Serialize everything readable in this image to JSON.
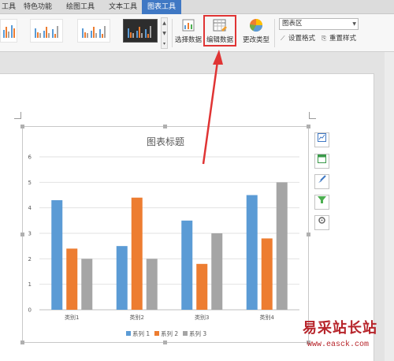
{
  "tabs": [
    {
      "label": "工具",
      "active": false
    },
    {
      "label": "特色功能",
      "active": false
    },
    {
      "label": "绘图工具",
      "active": false
    },
    {
      "label": "文本工具",
      "active": false
    },
    {
      "label": "图表工具",
      "active": true
    }
  ],
  "ribbon": {
    "select_data": "选择数据",
    "edit_data": "编辑数据",
    "change_type": "更改类型",
    "element_dropdown": "图表区",
    "set_format": "设置格式",
    "reset_style": "重置样式"
  },
  "chart_data": {
    "type": "bar",
    "title": "图表标题",
    "categories": [
      "类别1",
      "类别2",
      "类别3",
      "类别4"
    ],
    "series": [
      {
        "name": "系列 1",
        "values": [
          4.3,
          2.5,
          3.5,
          4.5
        ],
        "color": "#5b9bd5"
      },
      {
        "name": "系列 2",
        "values": [
          2.4,
          4.4,
          1.8,
          2.8
        ],
        "color": "#ed7d31"
      },
      {
        "name": "系列 3",
        "values": [
          2,
          2,
          3,
          5
        ],
        "color": "#a5a5a5"
      }
    ],
    "yticks": [
      "0",
      "1",
      "2",
      "3",
      "4",
      "5",
      "6"
    ],
    "ylim": [
      0,
      6
    ],
    "grid": true,
    "legend_position": "bottom"
  },
  "side_tools": [
    "chart-elements-icon",
    "chart-style-icon",
    "brush-icon",
    "filter-icon",
    "gear-icon"
  ],
  "watermark": {
    "text": "易采站长站",
    "url": "www.easck.com"
  }
}
